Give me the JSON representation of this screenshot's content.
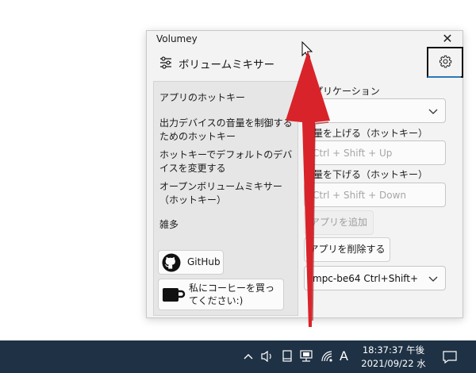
{
  "window": {
    "title": "Volumey",
    "close_glyph": "✕"
  },
  "header": {
    "title": "ボリュームミキサー",
    "icon": "sliders-icon"
  },
  "settings_button": {
    "icon": "gear-icon",
    "accent": "#2a7ab8"
  },
  "sidebar": {
    "items": [
      {
        "label": "アプリのホットキー"
      },
      {
        "label": "出力デバイスの音量を制御するためのホットキー"
      },
      {
        "label": "ホットキーでデフォルトのデバイスを変更する"
      },
      {
        "label": "オープンボリュームミキサー（ホットキー）"
      },
      {
        "label": "雑多"
      }
    ],
    "github_button": {
      "label": "GitHub",
      "icon": "github-icon"
    },
    "coffee_button": {
      "label": "私にコーヒーを買ってください:)",
      "icon": "coffee-cup-icon"
    }
  },
  "form": {
    "application_label": "アプリケーション",
    "application_value": "",
    "volume_up_label": "音量を上げる（ホットキー）",
    "volume_up_placeholder": "Ctrl + Shift + Up",
    "volume_down_label": "音量を下げる（ホットキー）",
    "volume_down_placeholder": "Ctrl + Shift + Down",
    "add_app_label": "アプリを追加",
    "remove_app_label": "アプリを削除する",
    "app_list_selected": "mpc-be64   Ctrl+Shift+"
  },
  "annotation": {
    "arrow_color": "#d9232a"
  },
  "taskbar": {
    "time": "18:37:37 午後",
    "date": "2021/09/22 水",
    "ime": "A",
    "icons": [
      "chevron-up-icon",
      "speaker-icon",
      "tablet-icon",
      "network-icon",
      "wifi-icon",
      "notification-icon"
    ],
    "background": "#1f3245"
  }
}
